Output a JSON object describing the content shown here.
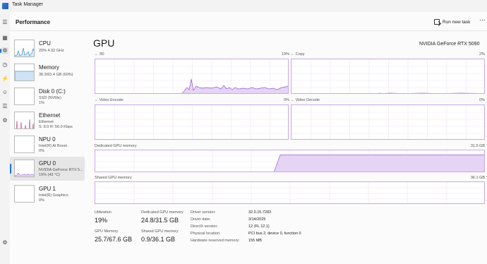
{
  "window": {
    "title": "Task Manager"
  },
  "header": {
    "section_title": "Performance",
    "run_new_task": "Run new task",
    "more": "⋯"
  },
  "rail": {
    "icons": [
      "hamburger-icon",
      "processes-icon",
      "performance-icon",
      "history-icon",
      "startup-icon",
      "users-icon",
      "details-icon",
      "services-icon",
      "settings-icon"
    ]
  },
  "perf_items": [
    {
      "name": "CPU",
      "sub1": "20%  4.92 GHz",
      "sub2": ""
    },
    {
      "name": "Memory",
      "sub1": "38.3/63.4 GB (60%)",
      "sub2": ""
    },
    {
      "name": "Disk 0 (C:)",
      "sub1": "SSD (NVMe)",
      "sub2": "1%"
    },
    {
      "name": "Ethernet",
      "sub1": "Ethernet",
      "sub2": "S: 8.0  R: 56.0 Kbps"
    },
    {
      "name": "NPU 0",
      "sub1": "Intel(R) AI Boost",
      "sub2": "0%"
    },
    {
      "name": "GPU 0",
      "sub1": "NVIDIA GeForce RTX 5...",
      "sub2": "19%  (43 °C)"
    },
    {
      "name": "GPU 1",
      "sub1": "Intel(R) Graphics",
      "sub2": "0%"
    }
  ],
  "main": {
    "title": "GPU",
    "model": "NVIDIA GeForce RTX 5090",
    "engines": [
      {
        "label": "3D",
        "pct": "19%"
      },
      {
        "label": "Copy",
        "pct": "2%"
      },
      {
        "label": "Video Encode",
        "pct": "0%"
      },
      {
        "label": "Video Decode",
        "pct": "0%"
      }
    ],
    "dedicated": {
      "label": "Dedicated GPU memory",
      "max": "31.5 GB"
    },
    "shared": {
      "label": "Shared GPU memory",
      "max": "36.1 GB"
    }
  },
  "stats": {
    "utilization": {
      "label": "Utilization",
      "value": "19%"
    },
    "dedicated_mem": {
      "label": "Dedicated GPU memory",
      "value": "24.8/31.5 GB"
    },
    "gpu_memory": {
      "label": "GPU Memory",
      "value": "25.7/67.6 GB"
    },
    "shared_mem": {
      "label": "Shared GPU memory",
      "value": "0.9/36.1 GB"
    }
  },
  "details": [
    {
      "key": "Driver version:",
      "value": "32.0.15.7283"
    },
    {
      "key": "Driver date:",
      "value": "3/14/2025"
    },
    {
      "key": "DirectX version:",
      "value": "12 (FL 12.1)"
    },
    {
      "key": "Physical location:",
      "value": "PCI bus 2, device 0, function 0"
    },
    {
      "key": "Hardware reserved memory:",
      "value": "155 MB"
    }
  ],
  "colors": {
    "gpu_line": "#9b59d0",
    "gpu_fill": "#e6d4f5",
    "grid": "#ece2f6",
    "accent": "#1a73d9"
  }
}
